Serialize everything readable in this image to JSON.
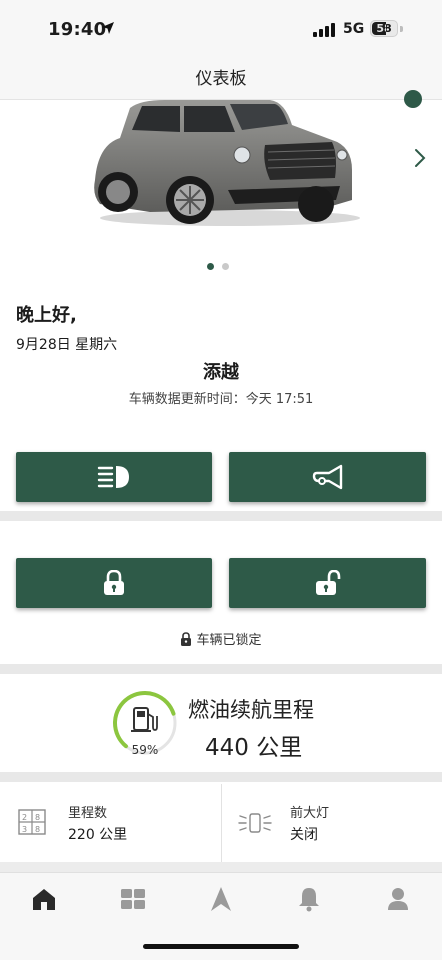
{
  "status_bar": {
    "time": "19:40",
    "network": "5G",
    "battery": "58"
  },
  "header": {
    "title": "仪表板"
  },
  "carousel": {
    "page_count": 2,
    "active_index": 0
  },
  "greeting": {
    "text": "晚上好,",
    "date": "9月28日 星期六"
  },
  "vehicle": {
    "name": "添越",
    "update_text": "车辆数据更新时间：今天 17:51"
  },
  "controls": {
    "headlight_icon": "headlight-icon",
    "horn_icon": "horn-icon",
    "lock_icon": "lock-icon",
    "unlock_icon": "unlock-icon"
  },
  "lock_status": {
    "text": "车辆已锁定"
  },
  "fuel": {
    "title": "燃油续航里程",
    "range": "440 公里",
    "percent_label": "59%",
    "level": 0.59
  },
  "tiles": {
    "odometer": {
      "label": "里程数",
      "value": "220 公里"
    },
    "headlights": {
      "label": "前大灯",
      "value": "关闭"
    }
  },
  "nav": {
    "items": [
      "home",
      "dashboard",
      "navigation",
      "notifications",
      "profile"
    ]
  },
  "colors": {
    "accent": "#2e5a48",
    "fuel_ring": "#8cc63f",
    "separator": "#e8e8e8"
  }
}
